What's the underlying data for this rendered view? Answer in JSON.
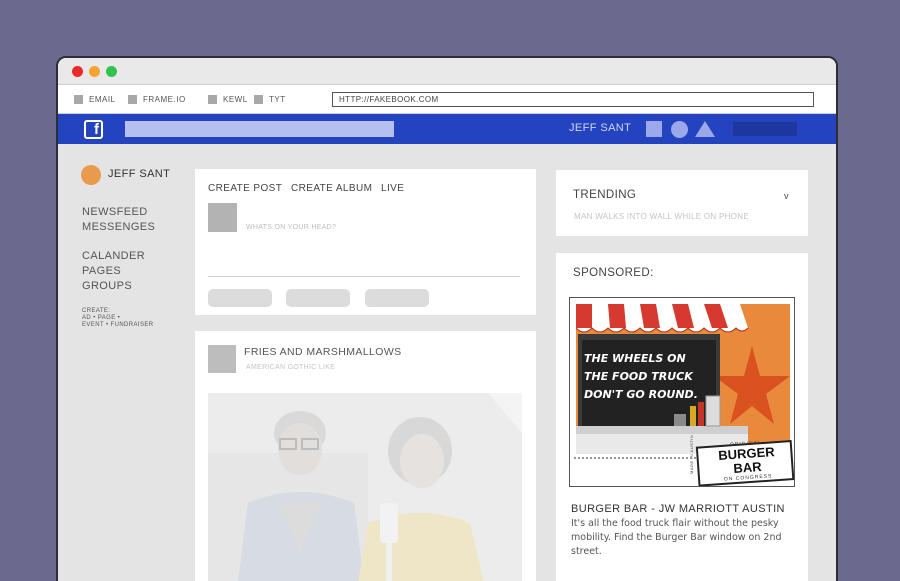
{
  "browser": {
    "bookmarks": [
      "EMAIL",
      "FRAME.IO",
      "KEWL",
      "TYT"
    ],
    "url": "HTTP://FAKEBOOK.COM"
  },
  "navbar": {
    "logo": "f",
    "user_name": "JEFF SANT"
  },
  "sidebar": {
    "user_name": "JEFF SANT",
    "items": [
      "NEWSFEED",
      "MESSENGES",
      "CALANDER",
      "PAGES",
      "GROUPS"
    ],
    "create_label": "CREATE:",
    "create_links_1": "AD • PAGE •",
    "create_links_2": "EVENT • FUNDRAISER"
  },
  "composer": {
    "tabs": [
      "CREATE POST",
      "CREATE ALBUM",
      "LIVE"
    ],
    "placeholder": "WHATS ON YOUR HEAD?"
  },
  "post": {
    "author": "FRIES AND MARSHMALLOWS",
    "subtitle": "AMERICAN GOTHIC LIKE"
  },
  "trending": {
    "title": "TRENDING",
    "chevron": "v",
    "item": "MAN WALKS INTO WALL WHILE ON PHONE"
  },
  "sponsored": {
    "title": "SPONSORED:",
    "ad_headline_1": "THE WHEELS ON",
    "ad_headline_2": "THE FOOD TRUCK",
    "ad_headline_3": "DON'T GO ROUND.",
    "ad_stamp_top": "ORIGINAL",
    "ad_brand": "BURGER BAR",
    "ad_stamp_bottom": "ON CONGRESS",
    "ad_side_text": "MADE IN AUSTIN",
    "ad_title": "BURGER BAR - JW MARRIOTT AUSTIN",
    "ad_description": "It's all the food truck flair without  the pesky mobility. Find the Burger Bar window on 2nd street."
  },
  "colors": {
    "background": "#6b6a8e",
    "navbar": "#2443bf",
    "avatar": "#e99a4d",
    "ad_orange": "#e8893c",
    "awning_red": "#d63a2e"
  }
}
